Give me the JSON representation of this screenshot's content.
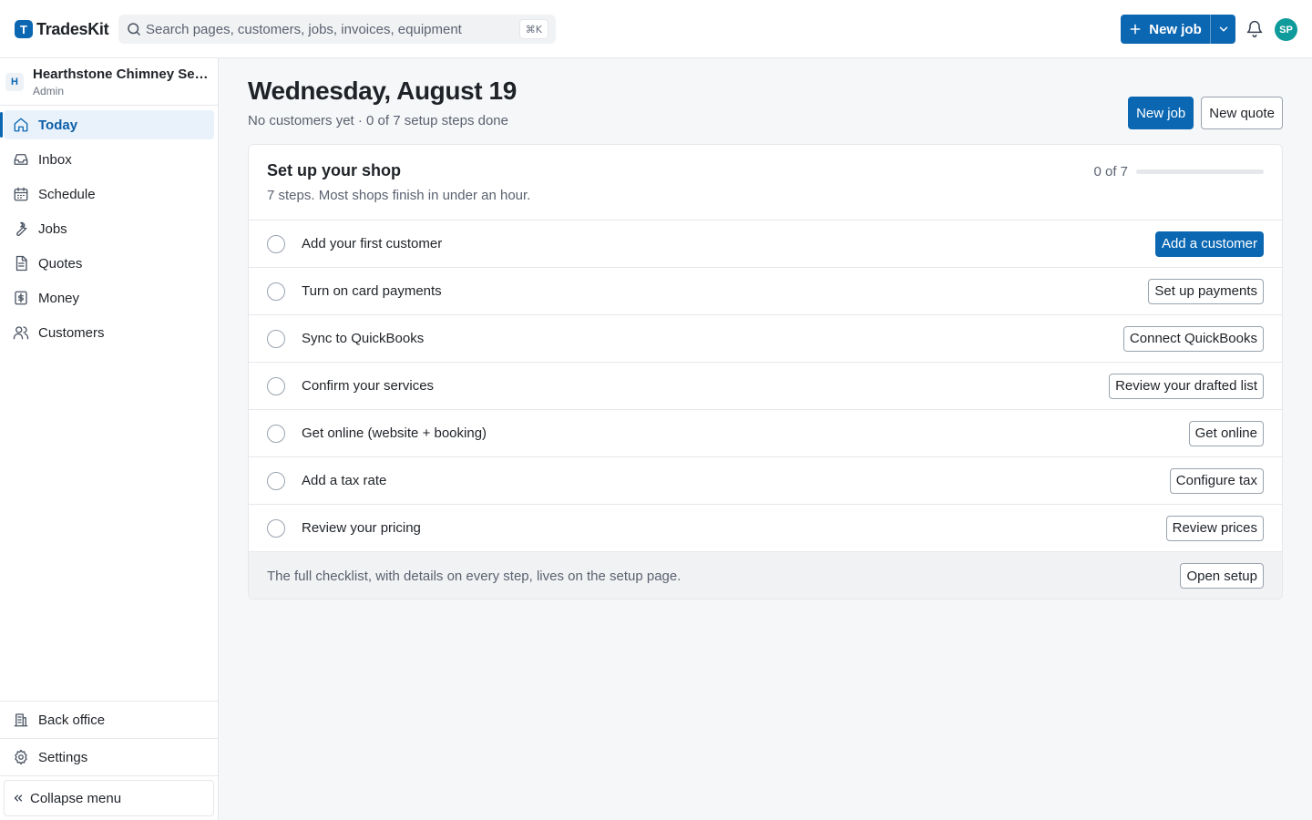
{
  "app": {
    "brand_letter": "T",
    "brand_name": "TradesKit"
  },
  "search": {
    "placeholder": "Search pages, customers, jobs, invoices, equipment",
    "shortcut": "⌘K"
  },
  "topbar": {
    "new_job_label": "New job",
    "avatar_initials": "SP"
  },
  "org": {
    "badge": "H",
    "name": "Hearthstone Chimney Services",
    "role": "Admin"
  },
  "sidebar": {
    "items": [
      {
        "label": "Today",
        "icon": "home-icon",
        "active": true
      },
      {
        "label": "Inbox",
        "icon": "inbox-icon"
      },
      {
        "label": "Schedule",
        "icon": "calendar-icon"
      },
      {
        "label": "Jobs",
        "icon": "wrench-icon"
      },
      {
        "label": "Quotes",
        "icon": "document-icon"
      },
      {
        "label": "Money",
        "icon": "dollar-icon"
      },
      {
        "label": "Customers",
        "icon": "users-icon"
      }
    ],
    "back_office": "Back office",
    "settings": "Settings",
    "collapse": "Collapse menu"
  },
  "page": {
    "title": "Wednesday, August 19",
    "subtitle": "No customers yet · 0 of 7 setup steps done",
    "new_job": "New job",
    "new_quote": "New quote"
  },
  "setup": {
    "title": "Set up your shop",
    "subtitle": "7 steps. Most shops finish in under an hour.",
    "progress_label": "0 of 7",
    "progress_fraction": 0,
    "steps": [
      {
        "label": "Add your first customer",
        "action": "Add a customer",
        "primary": true,
        "done": false
      },
      {
        "label": "Turn on card payments",
        "action": "Set up payments",
        "done": false
      },
      {
        "label": "Sync to QuickBooks",
        "action": "Connect QuickBooks",
        "done": false
      },
      {
        "label": "Confirm your services",
        "action": "Review your drafted list",
        "done": false
      },
      {
        "label": "Get online (website + booking)",
        "action": "Get online",
        "done": false
      },
      {
        "label": "Add a tax rate",
        "action": "Configure tax",
        "done": false
      },
      {
        "label": "Review your pricing",
        "action": "Review prices",
        "done": false
      }
    ],
    "footer_text": "The full checklist, with details on every step, lives on the setup page.",
    "footer_action": "Open setup"
  },
  "colors": {
    "accent": "#0b67b2",
    "avatar": "#0f9b9b"
  }
}
